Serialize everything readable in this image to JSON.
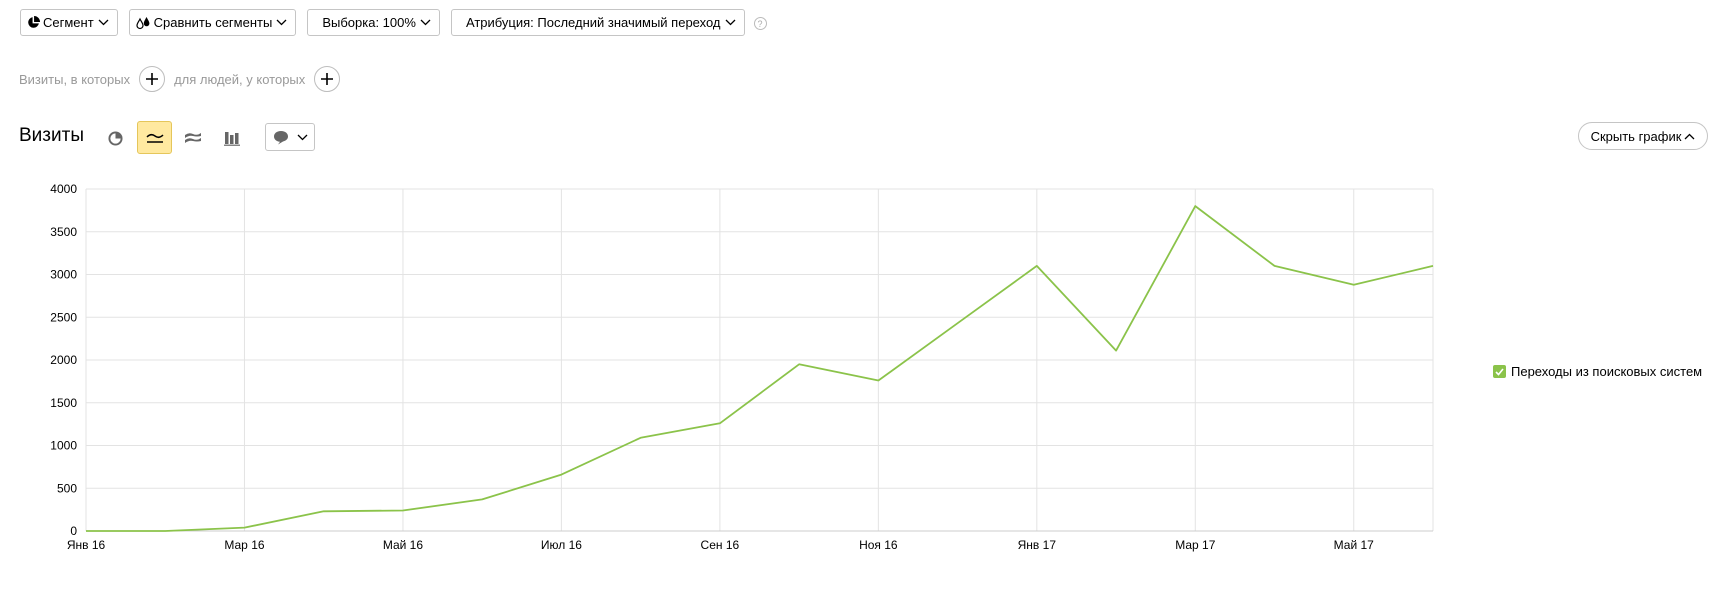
{
  "toolbar": {
    "segment": "Сегмент",
    "compare": "Сравнить сегменты",
    "sample": "Выборка: 100%",
    "attribution": "Атрибуция: Последний значимый переход",
    "help": "?"
  },
  "filters": {
    "visits_where": "Визиты, в которых",
    "for_people": "для людей, у которых"
  },
  "section_title": "Визиты",
  "hide_chart": "Скрыть график",
  "colors": {
    "accent": "#8bc34a",
    "active_view": "#ffe9a0",
    "active_view_border": "#e5c65a"
  },
  "icons": [
    "pie-chart-icon",
    "line-chart-icon",
    "stacked-area-icon",
    "bar-chart-icon",
    "comment-icon"
  ],
  "chart_data": {
    "type": "line",
    "title": "",
    "xlabel": "",
    "ylabel": "",
    "x": [
      "2016-01",
      "2016-02",
      "2016-03",
      "2016-04",
      "2016-05",
      "2016-06",
      "2016-07",
      "2016-08",
      "2016-09",
      "2016-10",
      "2016-11",
      "2016-12",
      "2017-01",
      "2017-02",
      "2017-03",
      "2017-04",
      "2017-05",
      "2017-06"
    ],
    "xtick_labels": [
      "Янв 16",
      "Мар 16",
      "Май 16",
      "Июл 16",
      "Сен 16",
      "Ноя 16",
      "Янв 17",
      "Мар 17",
      "Май 17"
    ],
    "ylim": [
      0,
      4000
    ],
    "yticks": [
      0,
      500,
      1000,
      1500,
      2000,
      2500,
      3000,
      3500,
      4000
    ],
    "grid": true,
    "legend_position": "right",
    "series": [
      {
        "name": "Переходы из поисковых систем",
        "color": "#8bc34a",
        "values": [
          0,
          0,
          40,
          230,
          240,
          370,
          660,
          1090,
          1260,
          1950,
          1760,
          2430,
          3100,
          2110,
          3800,
          3100,
          2880,
          3100
        ]
      }
    ]
  }
}
